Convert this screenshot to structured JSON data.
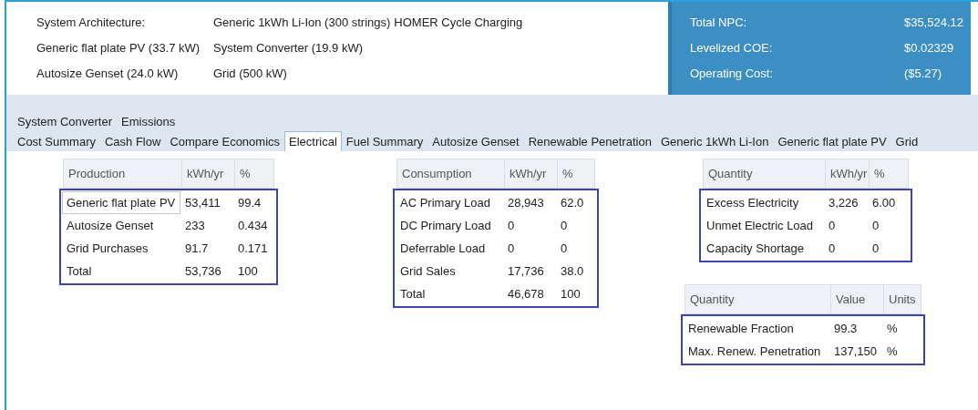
{
  "architecture": {
    "rows": [
      [
        "System Architecture:",
        "Generic 1kWh Li-Ion (300 strings)",
        "HOMER Cycle Charging"
      ],
      [
        "Generic flat plate PV (33.7 kW)",
        "System Converter (19.9 kW)"
      ],
      [
        "Autosize Genset (24.0 kW)",
        "Grid (500 kW)"
      ]
    ]
  },
  "summary": [
    {
      "label": "Total NPC:",
      "value": "$35,524.12"
    },
    {
      "label": "Levelized COE:",
      "value": "$0.02329"
    },
    {
      "label": "Operating Cost:",
      "value": "($5.27)"
    }
  ],
  "tab_rows": [
    [
      {
        "label": "System Converter",
        "selected": false
      },
      {
        "label": "Emissions",
        "selected": false
      }
    ],
    [
      {
        "label": "Cost Summary",
        "selected": false
      },
      {
        "label": "Cash Flow",
        "selected": false
      },
      {
        "label": "Compare Economics",
        "selected": false
      },
      {
        "label": "Electrical",
        "selected": true
      },
      {
        "label": "Fuel Summary",
        "selected": false
      },
      {
        "label": "Autosize Genset",
        "selected": false
      },
      {
        "label": "Renewable Penetration",
        "selected": false
      },
      {
        "label": "Generic 1kWh Li-Ion",
        "selected": false
      },
      {
        "label": "Generic flat plate PV",
        "selected": false
      },
      {
        "label": "Grid",
        "selected": false
      }
    ]
  ],
  "tables": [
    {
      "columns": [
        "Production",
        "kWh/yr",
        "%"
      ],
      "rows": [
        {
          "cells": [
            "Generic flat plate PV",
            "53,411",
            "99.4"
          ],
          "focused": true
        },
        {
          "cells": [
            "Autosize Genset",
            "233",
            "0.434"
          ],
          "focused": false
        },
        {
          "cells": [
            "Grid Purchases",
            "91.7",
            "0.171"
          ],
          "focused": false
        },
        {
          "cells": [
            "Total",
            "53,736",
            "100"
          ],
          "focused": false
        }
      ]
    },
    {
      "columns": [
        "Consumption",
        "kWh/yr",
        "%"
      ],
      "rows": [
        {
          "cells": [
            "AC Primary Load",
            "28,943",
            "62.0"
          ],
          "focused": false
        },
        {
          "cells": [
            "DC Primary Load",
            "0",
            "0"
          ],
          "focused": false
        },
        {
          "cells": [
            "Deferrable Load",
            "0",
            "0"
          ],
          "focused": false
        },
        {
          "cells": [
            "Grid Sales",
            "17,736",
            "38.0"
          ],
          "focused": false
        },
        {
          "cells": [
            "Total",
            "46,678",
            "100"
          ],
          "focused": false
        }
      ]
    },
    {
      "columns": [
        "Quantity",
        "kWh/yr",
        "%"
      ],
      "rows": [
        {
          "cells": [
            "Excess Electricity",
            "3,226",
            "6.00"
          ],
          "focused": false
        },
        {
          "cells": [
            "Unmet Electric Load",
            "0",
            "0"
          ],
          "focused": false
        },
        {
          "cells": [
            "Capacity Shortage",
            "0",
            "0"
          ],
          "focused": false
        }
      ]
    },
    {
      "columns": [
        "Quantity",
        "Value",
        "Units"
      ],
      "rows": [
        {
          "cells": [
            "Renewable Fraction",
            "99.3",
            "%"
          ],
          "focused": false
        },
        {
          "cells": [
            "Max. Renew. Penetration",
            "137,150",
            "%"
          ],
          "focused": false
        }
      ]
    }
  ]
}
